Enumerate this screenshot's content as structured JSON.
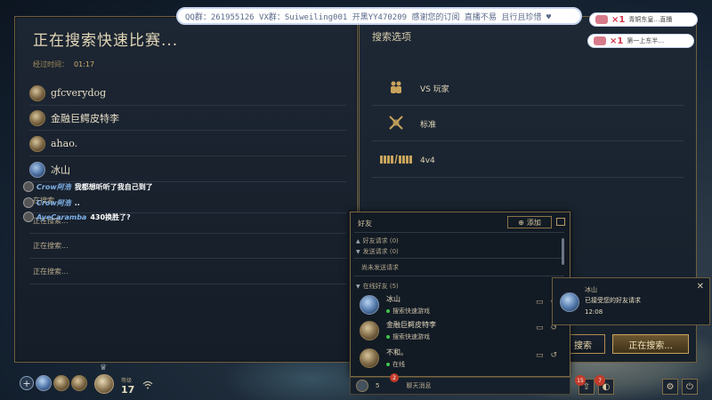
{
  "banner": {
    "text": "QQ群：261955126 VX群：Suiweiling001 开黑YY470209 感谢您的订阅 直播不易 且行且珍惜 ♥"
  },
  "gifts": [
    {
      "label": "×1",
      "name": "青铜东皇…直播"
    },
    {
      "label": "×1",
      "name": "第一上东半…"
    }
  ],
  "left_panel": {
    "title": "正在搜索快速比赛...",
    "elapsed_label": "经过时间：",
    "elapsed_value": "01:17",
    "players": [
      {
        "name": "gfcverydog"
      },
      {
        "name": "金融巨鳄皮特李"
      },
      {
        "name": "ahao."
      },
      {
        "name": "冰山"
      }
    ],
    "searching_rows": [
      "在搜索...",
      "正在搜索...",
      "正在搜索...",
      "正在搜索..."
    ]
  },
  "chat_overlay": [
    {
      "user": "Crow阿浩",
      "msg": "我都想听听了我自己到了"
    },
    {
      "user": "Crow阿浩",
      "msg": ".."
    },
    {
      "user": "AyeCaramba",
      "msg": "430换胜了?"
    }
  ],
  "right_panel": {
    "title": "搜索选项",
    "modes": [
      {
        "icon": "players-icon",
        "label": "VS 玩家"
      },
      {
        "icon": "crossed-swords-icon",
        "label": "标准"
      },
      {
        "icon": "team-vs-icon",
        "label": "4v4"
      }
    ],
    "search_button_partial": "搜索",
    "searching_button": "正在搜索..."
  },
  "friends": {
    "header": "好友",
    "add_label": "添加",
    "friend_requests": "好友请求 (0)",
    "sent_requests": "发送请求 (0)",
    "no_sent": "尚未发送请求",
    "online_friends": "在线好友 (5)",
    "list": [
      {
        "name": "冰山",
        "status": "搜索快速游戏"
      },
      {
        "name": "金融巨鳄皮特李",
        "status": "搜索快速游戏"
      },
      {
        "name": "不和。",
        "status": "在线"
      }
    ],
    "footer_count": "5",
    "footer_badge": "2",
    "footer_chat": "聊天消息"
  },
  "notification": {
    "name": "冰山",
    "text": "已接受您的好友请求",
    "time": "12:08"
  },
  "bottom": {
    "level_label": "等级",
    "level": "17",
    "badge_left": "15",
    "badge_right": "7"
  }
}
